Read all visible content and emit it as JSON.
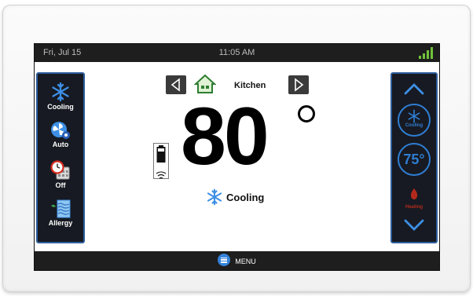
{
  "status": {
    "date": "Fri, Jul 15",
    "time": "11:05 AM",
    "signal_icon": "signal-bars-icon"
  },
  "modes": [
    {
      "label": "Cooling",
      "icon": "snowflake-icon"
    },
    {
      "label": "Auto",
      "icon": "fan-icon"
    },
    {
      "label": "Off",
      "icon": "schedule-clock-icon"
    },
    {
      "label": "Allergy",
      "icon": "air-filter-icon"
    }
  ],
  "room": {
    "name": "Kitchen",
    "prev_icon": "chevron-left-icon",
    "next_icon": "chevron-right-icon"
  },
  "current": {
    "temperature": "80",
    "mode_label": "Cooling"
  },
  "setpoint": {
    "cooling_label": "Cooling",
    "value": "75°",
    "heating_label": "Heating"
  },
  "menu": {
    "label": "MENU"
  },
  "colors": {
    "accent": "#2f7dd1",
    "panel_border": "#2c5d9c",
    "signal": "#6fc23a",
    "heat": "#b32a1c",
    "bar_bg": "#1e1e1e"
  }
}
